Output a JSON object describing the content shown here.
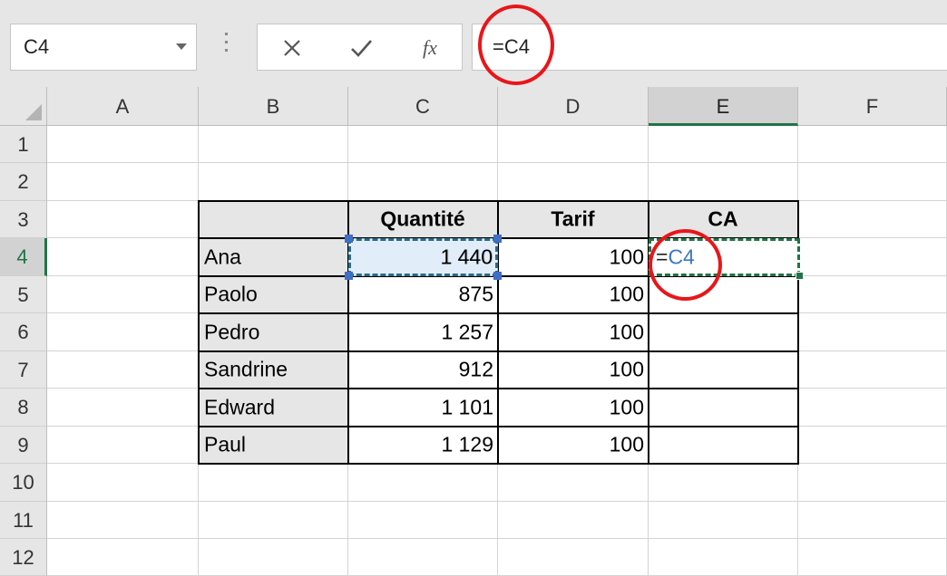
{
  "name_box": {
    "value": "C4"
  },
  "formula_bar": {
    "fx_label": "fx",
    "value": "=C4"
  },
  "columns": [
    {
      "label": "A",
      "selected": false
    },
    {
      "label": "B",
      "selected": false
    },
    {
      "label": "C",
      "selected": false
    },
    {
      "label": "D",
      "selected": false
    },
    {
      "label": "E",
      "selected": true
    },
    {
      "label": "F",
      "selected": false
    }
  ],
  "rows": [
    "1",
    "2",
    "3",
    "4",
    "5",
    "6",
    "7",
    "8",
    "9",
    "10",
    "11",
    "12"
  ],
  "selected_row": "4",
  "table": {
    "headers": [
      "",
      "Quantité",
      "Tarif",
      "CA"
    ],
    "rows": [
      {
        "name": "Ana",
        "quantite": "1 440",
        "tarif": "100"
      },
      {
        "name": "Paolo",
        "quantite": "875",
        "tarif": "100"
      },
      {
        "name": "Pedro",
        "quantite": "1 257",
        "tarif": "100"
      },
      {
        "name": "Sandrine",
        "quantite": "912",
        "tarif": "100"
      },
      {
        "name": "Edward",
        "quantite": "1 101",
        "tarif": "100"
      },
      {
        "name": "Paul",
        "quantite": "1 129",
        "tarif": "100"
      }
    ]
  },
  "active_cell": {
    "address": "E4",
    "prefix": "=",
    "reference": "C4"
  },
  "colors": {
    "excel_green": "#217346",
    "annotation_red": "#e8161a",
    "reference_blue": "#3c78c2"
  }
}
